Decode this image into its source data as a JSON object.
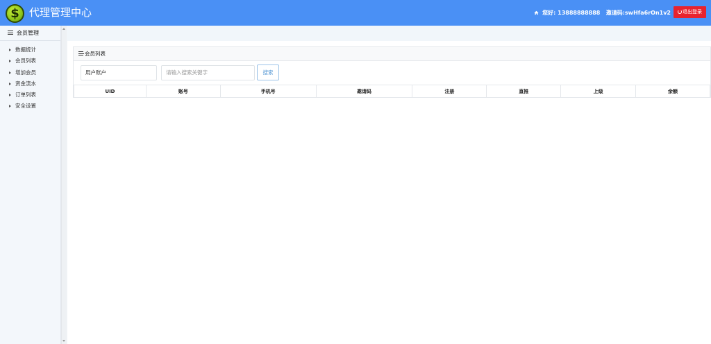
{
  "header": {
    "logo_symbol": "$",
    "title": "代理管理中心",
    "greeting": "您好: 13888888888",
    "invite": "邀请码:swHfa6rOn1v2",
    "logout_label": "退出登录",
    "bg_color": "#4a90f5",
    "logout_color": "#e8232f"
  },
  "sidebar": {
    "group_label": "会员管理",
    "items": [
      {
        "label": "数据统计"
      },
      {
        "label": "会员列表"
      },
      {
        "label": "增加会员"
      },
      {
        "label": "资金流水"
      },
      {
        "label": "订单列表"
      },
      {
        "label": "安全设置"
      }
    ]
  },
  "panel": {
    "title": "会员列表",
    "search": {
      "account_value": "用户账户",
      "keyword_placeholder": "请输入搜索关键字",
      "button_label": "搜索"
    },
    "table": {
      "columns": [
        "UID",
        "账号",
        "手机号",
        "邀请码",
        "注册",
        "直推",
        "上级",
        "余额"
      ],
      "rows": []
    }
  }
}
